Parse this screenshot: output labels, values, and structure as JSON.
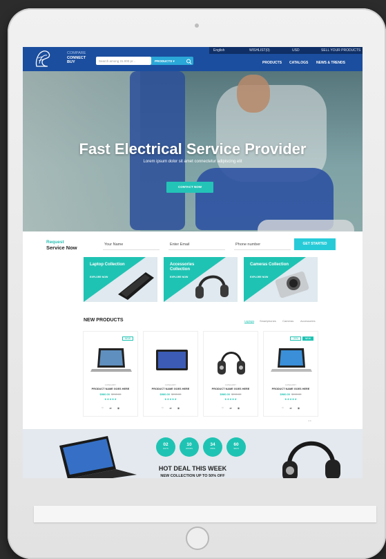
{
  "topbar": {
    "language": "English",
    "wishlist": "WISHLIST(0)",
    "cart": "USD",
    "sell": "SELL YOUR PRODUCTS"
  },
  "brand": {
    "line1": "COMPARE",
    "line2": "CONNECT",
    "line3": "BUY"
  },
  "search": {
    "placeholder": "Search among 31.000 pr...",
    "category": "PRODUCTS"
  },
  "nav": {
    "items": [
      "PRODUCTS",
      "CATALOGS",
      "NEWS & TRENDS"
    ]
  },
  "hero": {
    "title": "Fast Electrical Service Provider",
    "subtitle": "Lorem ipsum dolor sit amet connectetur adipiscing elit",
    "cta": "CONTACT NOW"
  },
  "request": {
    "title_1": "Request",
    "title_2": "Service Now",
    "name_placeholder": "Your Name",
    "email_placeholder": "Enter Email",
    "phone_placeholder": "Phone number",
    "button": "GET STARTED"
  },
  "collections": [
    {
      "title": "Laptop Collection",
      "sub": "EXPLORE NOW"
    },
    {
      "title": "Accessories Collection",
      "sub": "EXPLORE NOW"
    },
    {
      "title": "Cameras Collection",
      "sub": "EXPLORE NOW"
    }
  ],
  "new_products": {
    "title": "NEW PRODUCTS",
    "tabs": [
      "Laptops",
      "Smartphones",
      "Cameras",
      "Accessories"
    ],
    "items": [
      {
        "badge": "NEW",
        "badge2": "",
        "category": "CATEGORY",
        "name": "PRODUCT NAME GOES HERE",
        "price": "$980.00",
        "old_price": "$990.00",
        "stars": "★★★★★"
      },
      {
        "badge": "",
        "badge2": "",
        "category": "CATEGORY",
        "name": "PRODUCT NAME GOES HERE",
        "price": "$980.00",
        "old_price": "$990.00",
        "stars": "★★★★★"
      },
      {
        "badge": "",
        "badge2": "",
        "category": "CATEGORY",
        "name": "PRODUCT NAME GOES HERE",
        "price": "$980.00",
        "old_price": "$990.00",
        "stars": "★★★★★"
      },
      {
        "badge": "-30%",
        "badge2": "NEW",
        "category": "CATEGORY",
        "name": "PRODUCT NAME GOES HERE",
        "price": "$980.00",
        "old_price": "$990.00",
        "stars": "★★★★★"
      }
    ],
    "actions": [
      "♡",
      "⇄",
      "◉"
    ]
  },
  "hot_deal": {
    "timers": [
      {
        "value": "02",
        "unit": "DAYS"
      },
      {
        "value": "10",
        "unit": "HOURS"
      },
      {
        "value": "34",
        "unit": "MINS"
      },
      {
        "value": "60",
        "unit": "SECS"
      }
    ],
    "title": "HOT DEAL THIS WEEK",
    "subtitle": "NEW COLLECTION UP TO 50% OFF"
  },
  "colors": {
    "header": "#1b4e9e",
    "accent": "#1fc3b3",
    "tablet": "#ececec"
  }
}
